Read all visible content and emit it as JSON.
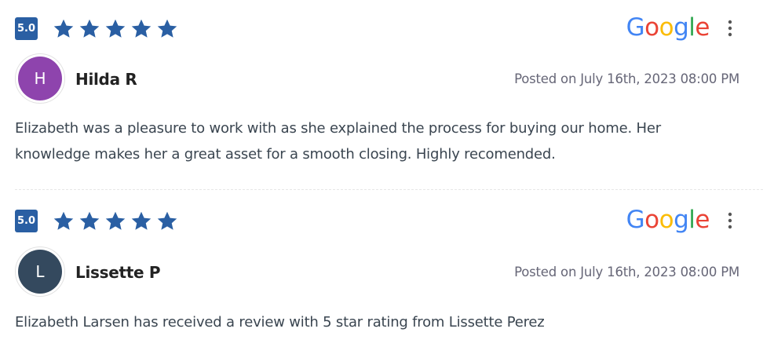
{
  "google_logo": {
    "letters": [
      "G",
      "o",
      "o",
      "g",
      "l",
      "e"
    ],
    "colors": [
      "#4285F4",
      "#EA4335",
      "#FBBC05",
      "#4285F4",
      "#34A853",
      "#EA4335"
    ]
  },
  "colors": {
    "star": "#2a5fa3",
    "score_badge": "#2a5fa3"
  },
  "reviews": [
    {
      "rating": "5.0",
      "stars": 5,
      "avatar_initial": "H",
      "avatar_color": "#8e44ad",
      "name": "Hilda R",
      "posted": "Posted on July 16th, 2023 08:00 PM",
      "body": "Elizabeth was a pleasure to work with as she explained the process for buying our home. Her knowledge makes her a great asset for a smooth closing. Highly recomended."
    },
    {
      "rating": "5.0",
      "stars": 5,
      "avatar_initial": "L",
      "avatar_color": "#34495e",
      "name": "Lissette P",
      "posted": "Posted on July 16th, 2023 08:00 PM",
      "body": "Elizabeth Larsen has received a review with 5 star rating from Lissette Perez"
    }
  ]
}
